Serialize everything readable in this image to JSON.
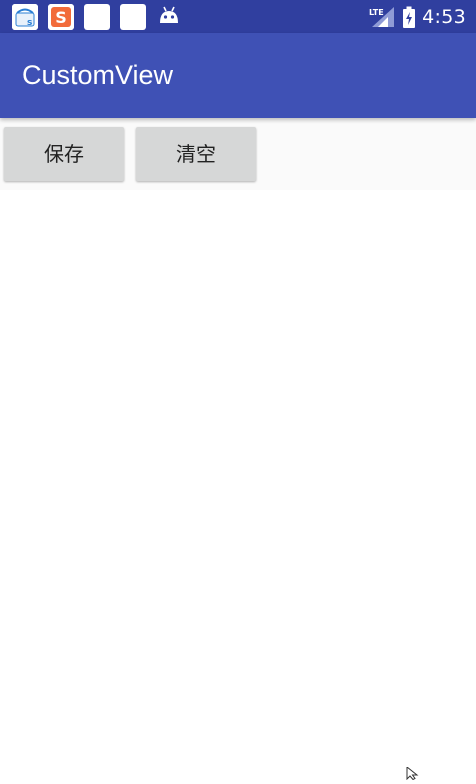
{
  "status_bar": {
    "notifications": [
      "store-icon",
      "sohu-s-icon",
      "blank-notification-icon",
      "blank-notification-icon",
      "android-icon"
    ],
    "network_label": "LTE",
    "time": "4:53"
  },
  "app_bar": {
    "title": "CustomView"
  },
  "toolbar": {
    "save_label": "保存",
    "clear_label": "清空"
  },
  "colors": {
    "status_bar": "#303f9f",
    "app_bar": "#3f51b5",
    "button": "#d6d7d7",
    "button_row": "#fafafa"
  }
}
